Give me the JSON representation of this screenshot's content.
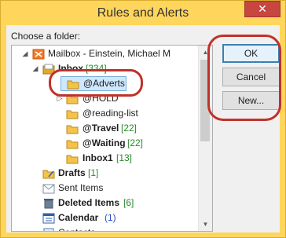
{
  "window": {
    "title": "Rules and Alerts",
    "close_glyph": "✕"
  },
  "dialog": {
    "folder_label": "Choose a folder:"
  },
  "buttons": {
    "ok": "OK",
    "cancel": "Cancel",
    "new": "New..."
  },
  "tree": {
    "mailbox": {
      "label": "Mailbox - Einstein, Michael M",
      "icon": "mailbox-icon"
    },
    "inbox": {
      "label": "Inbox",
      "count": "[334]"
    },
    "adverts": {
      "label": "@Adverts"
    },
    "hold": {
      "label": "@HOLD"
    },
    "reading_list": {
      "label": "@reading-list"
    },
    "travel": {
      "label": "@Travel",
      "count": "[22]"
    },
    "waiting": {
      "label": "@Waiting",
      "count": "[22]"
    },
    "inbox1": {
      "label": "Inbox1",
      "count": "[13]"
    },
    "drafts": {
      "label": "Drafts",
      "count": "[1]"
    },
    "sent": {
      "label": "Sent Items"
    },
    "deleted": {
      "label": "Deleted Items",
      "count": "[6]"
    },
    "calendar": {
      "label": "Calendar",
      "count": "(1)"
    },
    "contacts": {
      "label": "Contacts"
    }
  },
  "colors": {
    "accent_ring": "#c0312b",
    "selection": "#cde8ff",
    "titlebar": "#ffd65c",
    "close": "#c7463f"
  }
}
